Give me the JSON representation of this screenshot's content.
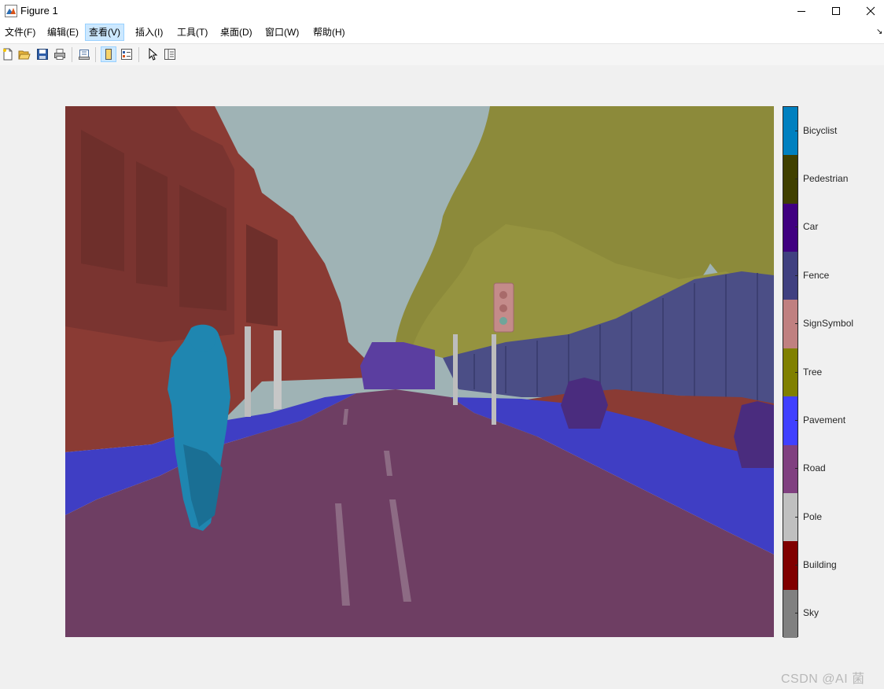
{
  "window": {
    "title": "Figure 1"
  },
  "menu": [
    {
      "label": "文件(F)",
      "active": false
    },
    {
      "label": "编辑(E)",
      "active": false
    },
    {
      "label": "查看(V)",
      "active": true
    },
    {
      "label": "插入(I)",
      "active": false
    },
    {
      "label": "工具(T)",
      "active": false
    },
    {
      "label": "桌面(D)",
      "active": false
    },
    {
      "label": "窗口(W)",
      "active": false
    },
    {
      "label": "帮助(H)",
      "active": false
    }
  ],
  "toolbar": [
    {
      "icon": "new-figure-icon"
    },
    {
      "icon": "open-folder-icon"
    },
    {
      "icon": "save-icon"
    },
    {
      "icon": "print-icon"
    },
    {
      "icon": "link-plot-icon"
    },
    {
      "icon": "hide-plot-tools-icon",
      "pressed": true
    },
    {
      "icon": "show-plot-tools-icon"
    },
    {
      "icon": "edit-plot-pointer-icon"
    },
    {
      "icon": "property-inspector-icon"
    }
  ],
  "colorbar": {
    "labels": [
      "Bicyclist",
      "Pedestrian",
      "Car",
      "Fence",
      "SignSymbol",
      "Tree",
      "Pavement",
      "Road",
      "Pole",
      "Building",
      "Sky"
    ],
    "colors": [
      "#0080c0",
      "#404000",
      "#400080",
      "#404080",
      "#c08080",
      "#808000",
      "#4040ff",
      "#804080",
      "#c0c0c0",
      "#800000",
      "#808080"
    ]
  },
  "watermark": "CSDN @AI 菌"
}
